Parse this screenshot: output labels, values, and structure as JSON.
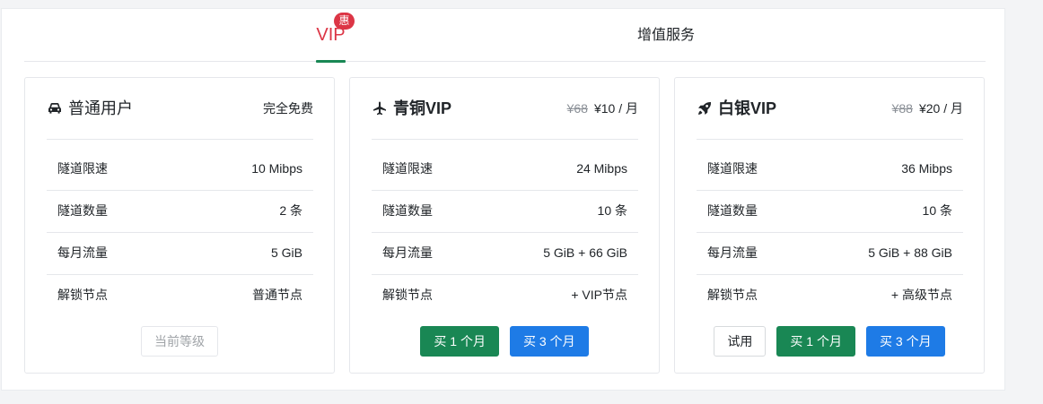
{
  "tabs": {
    "vip": {
      "label": "VIP",
      "badge": "惠"
    },
    "service": {
      "label": "增值服务"
    }
  },
  "plans": [
    {
      "name": "普通用户",
      "icon": "car-icon",
      "price_text": "完全免费",
      "rows": [
        {
          "key": "隧道限速",
          "value": "10 Mibps"
        },
        {
          "key": "隧道数量",
          "value": "2 条"
        },
        {
          "key": "每月流量",
          "value": "5 GiB"
        },
        {
          "key": "解锁节点",
          "value": "普通节点"
        }
      ],
      "buttons": [
        {
          "label": "当前等级"
        }
      ]
    },
    {
      "name": "青铜VIP",
      "icon": "plane-icon",
      "old_price": "¥68",
      "price": "¥10 / 月",
      "rows": [
        {
          "key": "隧道限速",
          "value": "24 Mibps"
        },
        {
          "key": "隧道数量",
          "value": "10 条"
        },
        {
          "key": "每月流量",
          "value": "5 GiB + 66 GiB"
        },
        {
          "key": "解锁节点",
          "value": "+ VIP节点"
        }
      ],
      "buttons": [
        {
          "label": "买 1 个月"
        },
        {
          "label": "买 3 个月"
        }
      ]
    },
    {
      "name": "白银VIP",
      "icon": "rocket-icon",
      "old_price": "¥88",
      "price": "¥20 / 月",
      "rows": [
        {
          "key": "隧道限速",
          "value": "36 Mibps"
        },
        {
          "key": "隧道数量",
          "value": "10 条"
        },
        {
          "key": "每月流量",
          "value": "5 GiB + 88 GiB"
        },
        {
          "key": "解锁节点",
          "value": "+ 高级节点"
        }
      ],
      "buttons": [
        {
          "label": "试用"
        },
        {
          "label": "买 1 个月"
        },
        {
          "label": "买 3 个月"
        }
      ]
    }
  ],
  "colors": {
    "accent_red": "#dc3545",
    "green": "#198754",
    "blue": "#1e7be6"
  }
}
